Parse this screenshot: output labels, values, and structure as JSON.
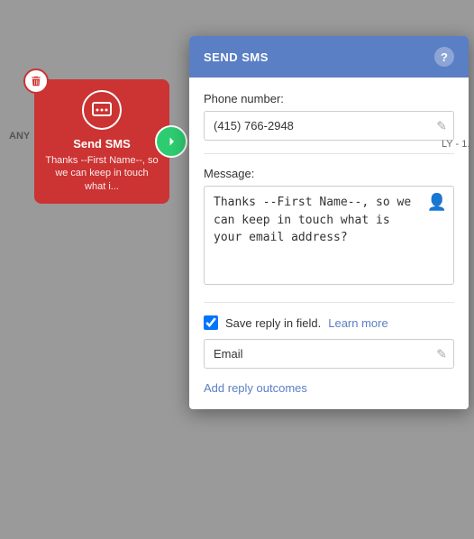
{
  "canvas": {
    "any_label": "ANY"
  },
  "sms_node": {
    "title": "Send SMS",
    "description": "Thanks --First Name--, so we can keep in touch what i...",
    "delete_label": "delete"
  },
  "panel": {
    "header": {
      "title": "SEND SMS",
      "help_label": "?"
    },
    "phone_number": {
      "label": "Phone number:",
      "value": "(415) 766-2948"
    },
    "message": {
      "label": "Message:",
      "value": "Thanks --First Name--, so we can keep in touch what is your email address?"
    },
    "save_reply": {
      "label": "Save reply in field.",
      "learn_more": "Learn more",
      "checked": true
    },
    "email_field": {
      "value": "Email"
    },
    "add_reply_outcomes": "Add reply outcomes"
  },
  "close_btn": "×"
}
